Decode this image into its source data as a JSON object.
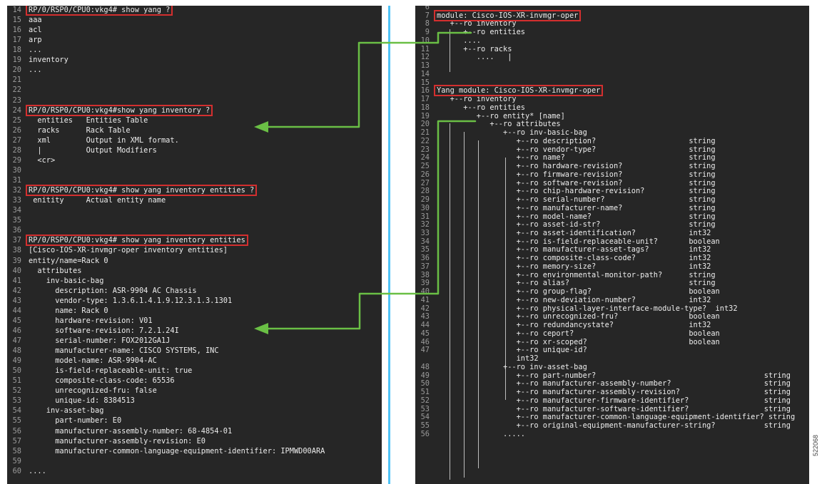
{
  "left_terminal": {
    "lines": [
      {
        "n": "14",
        "t": "RP/0/RSP0/CPU0:vkg4# show yang ?"
      },
      {
        "n": "15",
        "t": "aaa"
      },
      {
        "n": "16",
        "t": "acl"
      },
      {
        "n": "17",
        "t": "arp"
      },
      {
        "n": "18",
        "t": "..."
      },
      {
        "n": "19",
        "t": "inventory"
      },
      {
        "n": "20",
        "t": "..."
      },
      {
        "n": "21",
        "t": ""
      },
      {
        "n": "22",
        "t": ""
      },
      {
        "n": "23",
        "t": ""
      },
      {
        "n": "24",
        "t": "RP/0/RSP0/CPU0:vkg4#show yang inventory ?"
      },
      {
        "n": "25",
        "t": "  entities   Entities Table"
      },
      {
        "n": "26",
        "t": "  racks      Rack Table"
      },
      {
        "n": "27",
        "t": "  xml        Output in XML format."
      },
      {
        "n": "28",
        "t": "  |          Output Modifiers"
      },
      {
        "n": "29",
        "t": "  <cr>"
      },
      {
        "n": "30",
        "t": ""
      },
      {
        "n": "31",
        "t": ""
      },
      {
        "n": "32",
        "t": "RP/0/RSP0/CPU0:vkg4# show yang inventory entities ?"
      },
      {
        "n": "33",
        "t": " enitity     Actual entity name"
      },
      {
        "n": "34",
        "t": ""
      },
      {
        "n": "35",
        "t": ""
      },
      {
        "n": "36",
        "t": ""
      },
      {
        "n": "37",
        "t": "RP/0/RSP0/CPU0:vkg4# show yang inventory entities"
      },
      {
        "n": "38",
        "t": "[Cisco-IOS-XR-invmgr-oper inventory entities]"
      },
      {
        "n": "39",
        "t": "entity/name=Rack 0"
      },
      {
        "n": "40",
        "t": "  attributes"
      },
      {
        "n": "41",
        "t": "    inv-basic-bag"
      },
      {
        "n": "42",
        "t": "      description: ASR-9904 AC Chassis"
      },
      {
        "n": "43",
        "t": "      vendor-type: 1.3.6.1.4.1.9.12.3.1.3.1301"
      },
      {
        "n": "44",
        "t": "      name: Rack 0"
      },
      {
        "n": "45",
        "t": "      hardware-revision: V01"
      },
      {
        "n": "46",
        "t": "      software-revision: 7.2.1.24I"
      },
      {
        "n": "47",
        "t": "      serial-number: FOX2012GA1J"
      },
      {
        "n": "48",
        "t": "      manufacturer-name: CISCO SYSTEMS, INC"
      },
      {
        "n": "49",
        "t": "      model-name: ASR-9904-AC"
      },
      {
        "n": "50",
        "t": "      is-field-replaceable-unit: true"
      },
      {
        "n": "51",
        "t": "      composite-class-code: 65536"
      },
      {
        "n": "52",
        "t": "      unrecognized-fru: false"
      },
      {
        "n": "53",
        "t": "      unique-id: 8384513"
      },
      {
        "n": "54",
        "t": "    inv-asset-bag"
      },
      {
        "n": "55",
        "t": "      part-number: E0"
      },
      {
        "n": "56",
        "t": "      manufacturer-assembly-number: 68-4854-01"
      },
      {
        "n": "57",
        "t": "      manufacturer-assembly-revision: E0"
      },
      {
        "n": "58",
        "t": "      manufacturer-common-language-equipment-identifier: IPMWD00ARA"
      },
      {
        "n": "59",
        "t": ""
      },
      {
        "n": "60",
        "t": "...."
      }
    ]
  },
  "right_terminal": {
    "lines": [
      {
        "n": "6",
        "t": ""
      },
      {
        "n": "7",
        "t": "module: Cisco-IOS-XR-invmgr-oper"
      },
      {
        "n": "8",
        "t": "   +--ro inventory"
      },
      {
        "n": "9",
        "t": "      +--ro entities"
      },
      {
        "n": "10",
        "t": "      ...."
      },
      {
        "n": "11",
        "t": "      +--ro racks"
      },
      {
        "n": "12",
        "t": "         ....   |"
      },
      {
        "n": "13",
        "t": ""
      },
      {
        "n": "14",
        "t": ""
      },
      {
        "n": "15",
        "t": ""
      },
      {
        "n": "16",
        "t": "Yang module: Cisco-IOS-XR-invmgr-oper"
      },
      {
        "n": "17",
        "t": "   +--ro inventory"
      },
      {
        "n": "18",
        "t": "      +--ro entities"
      },
      {
        "n": "19",
        "t": "         +--ro entity* [name]"
      },
      {
        "n": "20",
        "t": "            +--ro attributes"
      },
      {
        "n": "21",
        "t": "               +--ro inv-basic-bag"
      },
      {
        "n": "22",
        "t": "                  +--ro description?                     string"
      },
      {
        "n": "23",
        "t": "                  +--ro vendor-type?                     string"
      },
      {
        "n": "24",
        "t": "                  +--ro name?                            string"
      },
      {
        "n": "25",
        "t": "                  +--ro hardware-revision?               string"
      },
      {
        "n": "26",
        "t": "                  +--ro firmware-revision?               string"
      },
      {
        "n": "27",
        "t": "                  +--ro software-revision?               string"
      },
      {
        "n": "28",
        "t": "                  +--ro chip-hardware-revision?          string"
      },
      {
        "n": "29",
        "t": "                  +--ro serial-number?                   string"
      },
      {
        "n": "30",
        "t": "                  +--ro manufacturer-name?               string"
      },
      {
        "n": "31",
        "t": "                  +--ro model-name?                      string"
      },
      {
        "n": "32",
        "t": "                  +--ro asset-id-str?                    string"
      },
      {
        "n": "33",
        "t": "                  +--ro asset-identification?            int32"
      },
      {
        "n": "34",
        "t": "                  +--ro is-field-replaceable-unit?       boolean"
      },
      {
        "n": "35",
        "t": "                  +--ro manufacturer-asset-tags?         int32"
      },
      {
        "n": "36",
        "t": "                  +--ro composite-class-code?            int32"
      },
      {
        "n": "37",
        "t": "                  +--ro memory-size?                     int32"
      },
      {
        "n": "38",
        "t": "                  +--ro environmental-monitor-path?      string"
      },
      {
        "n": "39",
        "t": "                  +--ro alias?                           string"
      },
      {
        "n": "40",
        "t": "                  +--ro group-flag?                      boolean"
      },
      {
        "n": "41",
        "t": "                  +--ro new-deviation-number?            int32"
      },
      {
        "n": "42",
        "t": "                  +--ro physical-layer-interface-module-type?  int32"
      },
      {
        "n": "43",
        "t": "                  +--ro unrecognized-fru?                boolean"
      },
      {
        "n": "44",
        "t": "                  +--ro redundancystate?                 int32"
      },
      {
        "n": "45",
        "t": "                  +--ro ceport?                          boolean"
      },
      {
        "n": "46",
        "t": "                  +--ro xr-scoped?                       boolean"
      },
      {
        "n": "47",
        "t": "                  +--ro unique-id?"
      },
      {
        "n": "",
        "t": "                  int32"
      },
      {
        "n": "48",
        "t": "               +--ro inv-asset-bag"
      },
      {
        "n": "49",
        "t": "                  +--ro part-number?                                      string"
      },
      {
        "n": "50",
        "t": "                  +--ro manufacturer-assembly-number?                     string"
      },
      {
        "n": "51",
        "t": "                  +--ro manufacturer-assembly-revision?                   string"
      },
      {
        "n": "52",
        "t": "                  +--ro manufacturer-firmware-identifier?                 string"
      },
      {
        "n": "53",
        "t": "                  +--ro manufacturer-software-identifier?                 string"
      },
      {
        "n": "54",
        "t": "                  +--ro manufacturer-common-language-equipment-identifier? string"
      },
      {
        "n": "55",
        "t": "                  +--ro original-equipment-manufacturer-string?           string"
      },
      {
        "n": "56",
        "t": "               ....."
      }
    ]
  },
  "figure_id": "522068",
  "colors": {
    "terminal_bg": "#262626",
    "highlight_box": "#d32f2f",
    "connector_arrow": "#6abf45",
    "divider": "#4fc3f7"
  }
}
